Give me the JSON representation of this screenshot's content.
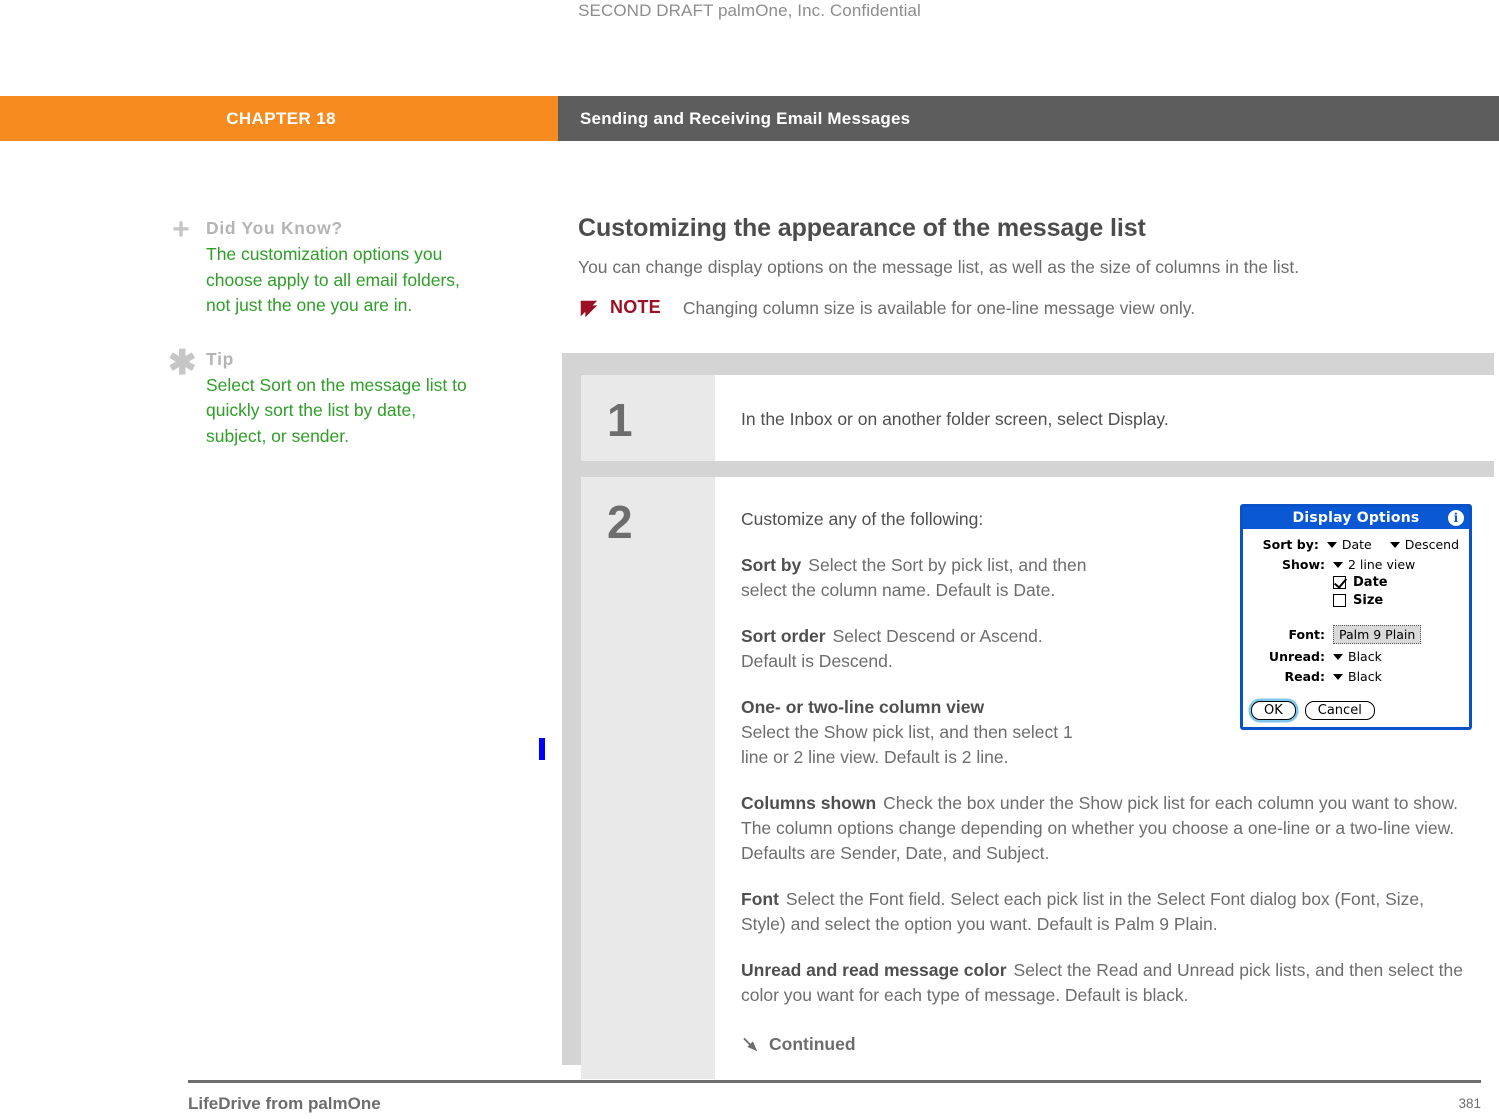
{
  "running_head": "SECOND DRAFT palmOne, Inc.  Confidential",
  "chapter_bar": {
    "chapter_label": "CHAPTER 18",
    "chapter_title": "Sending and Receiving Email Messages",
    "orange": "#f68b1f",
    "gray": "#5d5d5d"
  },
  "sidebar": {
    "blocks": [
      {
        "icon": "plus-icon",
        "title": "Did You Know?",
        "body": "The customization options you choose apply to all email folders, not just the one you are in."
      },
      {
        "icon": "asterisk-icon",
        "title": "Tip",
        "body": "Select Sort on the message list to quickly sort the list by date, subject, or sender."
      }
    ],
    "text_color": "#2e9e27",
    "title_color": "#b4b4b4"
  },
  "main": {
    "section_title": "Customizing the appearance of the message list",
    "lead": "You can change display options on the message list, as well as the size of columns in the list.",
    "note": {
      "label": "NOTE",
      "text": "Changing column size is available for one-line message view only.",
      "color": "#9c1024"
    }
  },
  "steps": [
    {
      "number": "1",
      "text": "In the Inbox or on another folder screen, select Display."
    },
    {
      "number": "2",
      "lead": "Customize any of the following:",
      "items": [
        {
          "term": "Sort by",
          "desc": "Select the Sort by pick list, and then select the column name. Default is Date.",
          "width": "narrow"
        },
        {
          "term": "Sort order",
          "desc": "Select Descend or Ascend. Default is Descend.",
          "width": "narrow"
        },
        {
          "term": "One- or two-line column view",
          "desc": "Select the Show pick list, and then select 1 line or 2 line view. Default is 2 line.",
          "width": "narrow",
          "term_on_own_line": true
        },
        {
          "term": "Columns shown",
          "desc": "Check the box under the Show pick list for each column you want to show. The column options change depending on whether you choose a one-line or a two-line view. Defaults are Sender, Date, and Subject.",
          "width": "wide"
        },
        {
          "term": "Font",
          "desc": "Select the Font field. Select each pick list in the Select Font dialog box (Font, Size, Style) and select the option you want. Default is Palm 9 Plain.",
          "width": "wide"
        },
        {
          "term": "Unread and read message color",
          "desc": "Select the Read and Unread pick lists, and then select the color you want for each type of message. Default is black.",
          "width": "wide"
        }
      ],
      "continued_label": "Continued",
      "continued_icon": "arrow-down-right-icon"
    }
  ],
  "palm_dialog": {
    "title": "Display Options",
    "info_icon": "info-icon",
    "title_bar_color": "#0b58d4",
    "rows": {
      "sort_by_label": "Sort by:",
      "sort_by_value": "Date",
      "sort_order_value": "Descend",
      "show_label": "Show:",
      "show_value": "2 line view",
      "checkbox_date_label": "Date",
      "checkbox_date_checked": true,
      "checkbox_size_label": "Size",
      "checkbox_size_checked": false,
      "font_label": "Font:",
      "font_value": "Palm 9 Plain",
      "unread_label": "Unread:",
      "unread_value": "Black",
      "read_label": "Read:",
      "read_value": "Black"
    },
    "buttons": {
      "ok": "OK",
      "cancel": "Cancel"
    }
  },
  "footer": {
    "left": "LifeDrive from palmOne",
    "page_number": "381"
  }
}
